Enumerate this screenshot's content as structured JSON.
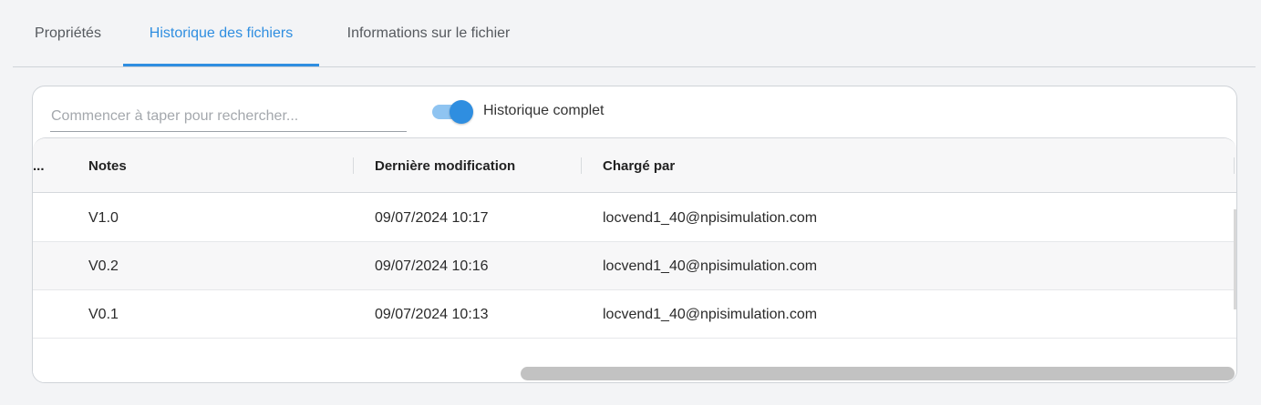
{
  "tabs": [
    {
      "label": "Propriétés",
      "active": false
    },
    {
      "label": "Historique des fichiers",
      "active": true
    },
    {
      "label": "Informations sur le fichier",
      "active": false
    }
  ],
  "search": {
    "placeholder": "Commencer à taper pour rechercher...",
    "value": ""
  },
  "toggle": {
    "label": "Historique complet",
    "on": true
  },
  "grid": {
    "columns": [
      "...",
      "Notes",
      "Dernière modification",
      "Chargé par"
    ],
    "rows": [
      {
        "notes": "V1.0",
        "modified": "09/07/2024 10:17",
        "uploaded_by": "locvend1_40@npisimulation.com"
      },
      {
        "notes": "V0.2",
        "modified": "09/07/2024 10:16",
        "uploaded_by": "locvend1_40@npisimulation.com"
      },
      {
        "notes": "V0.1",
        "modified": "09/07/2024 10:13",
        "uploaded_by": "locvend1_40@npisimulation.com"
      }
    ]
  },
  "colors": {
    "accent": "#2f8ee0",
    "toggle_track": "#8fc4f1",
    "background": "#f3f4f6"
  }
}
